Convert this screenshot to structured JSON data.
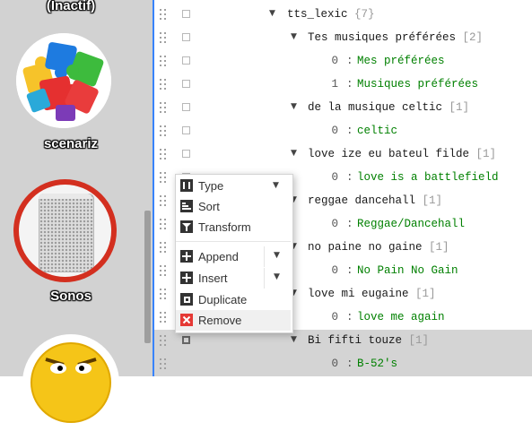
{
  "sidebar": {
    "apps": [
      {
        "label": "(Inactif)",
        "icon": "puzzle-icon"
      },
      {
        "label": "scenariz",
        "icon": "puzzle-icon"
      },
      {
        "label": "Sonos",
        "icon": "sonos-speaker-icon"
      },
      {
        "label": "",
        "icon": "angry-emoji-icon"
      }
    ]
  },
  "tree": {
    "rows": [
      {
        "type": "object",
        "key": "tts_lexic",
        "count": "{7}"
      },
      {
        "type": "array",
        "key": "Tes musiques préférées",
        "count": "[2]"
      },
      {
        "type": "item",
        "index": "0",
        "value": "Mes préférées"
      },
      {
        "type": "item",
        "index": "1",
        "value": "Musiques préférées"
      },
      {
        "type": "array",
        "key": "de la musique celtic",
        "count": "[1]"
      },
      {
        "type": "item",
        "index": "0",
        "value": "celtic"
      },
      {
        "type": "array",
        "key": "love ize eu bateul filde",
        "count": "[1]"
      },
      {
        "type": "item",
        "index": "0",
        "value": "love is a battlefield"
      },
      {
        "type": "array",
        "key": "reggae dancehall",
        "count": "[1]"
      },
      {
        "type": "item",
        "index": "0",
        "value": "Reggae/Dancehall"
      },
      {
        "type": "array",
        "key": "no paine no gaine",
        "count": "[1]"
      },
      {
        "type": "item",
        "index": "0",
        "value": "No Pain No Gain"
      },
      {
        "type": "array",
        "key": "love mi eugaine",
        "count": "[1]"
      },
      {
        "type": "item",
        "index": "0",
        "value": "love me again"
      },
      {
        "type": "array",
        "key": "Bi fifti touze",
        "count": "[1]"
      },
      {
        "type": "item",
        "index": "0",
        "value": "B-52's"
      }
    ],
    "separator": ":"
  },
  "context_menu": {
    "type": "Type",
    "sort": "Sort",
    "transform": "Transform",
    "append": "Append",
    "insert": "Insert",
    "duplicate": "Duplicate",
    "remove": "Remove"
  },
  "colors": {
    "accent": "#3883fa",
    "value_green": "#008000",
    "remove_red": "#e53935"
  }
}
